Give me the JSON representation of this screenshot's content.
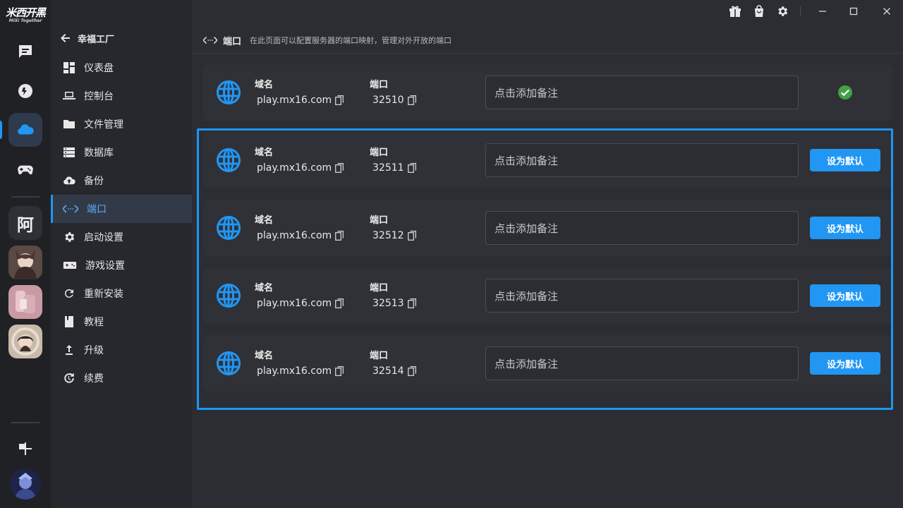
{
  "app": {
    "logo_text": "米西开黑",
    "logo_sub": "MiXi Together",
    "rail_avatar_text": "阿"
  },
  "nav": {
    "back_title": "幸福工厂",
    "items": [
      {
        "label": "仪表盘",
        "icon": "dashboard-icon"
      },
      {
        "label": "控制台",
        "icon": "laptop-icon"
      },
      {
        "label": "文件管理",
        "icon": "folder-icon"
      },
      {
        "label": "数据库",
        "icon": "database-icon"
      },
      {
        "label": "备份",
        "icon": "cloud-upload-icon"
      },
      {
        "label": "端口",
        "icon": "port-icon"
      },
      {
        "label": "启动设置",
        "icon": "gear-icon"
      },
      {
        "label": "游戏设置",
        "icon": "controller-icon"
      },
      {
        "label": "重新安装",
        "icon": "refresh-icon"
      },
      {
        "label": "教程",
        "icon": "book-icon"
      },
      {
        "label": "升级",
        "icon": "upgrade-icon"
      },
      {
        "label": "续费",
        "icon": "renew-icon"
      }
    ]
  },
  "page": {
    "title": "端口",
    "description": "在此页面可以配置服务器的端口映射，管理对外开放的端口"
  },
  "labels": {
    "domain": "域名",
    "port": "端口",
    "note_placeholder": "点击添加备注",
    "set_default": "设为默认"
  },
  "ports": [
    {
      "domain": "play.mx16.com",
      "port": "32510",
      "is_default": true
    },
    {
      "domain": "play.mx16.com",
      "port": "32511",
      "is_default": false
    },
    {
      "domain": "play.mx16.com",
      "port": "32512",
      "is_default": false
    },
    {
      "domain": "play.mx16.com",
      "port": "32513",
      "is_default": false
    },
    {
      "domain": "play.mx16.com",
      "port": "32514",
      "is_default": false
    }
  ],
  "colors": {
    "accent": "#2196f3",
    "success": "#43a047",
    "background": "#2b2d33"
  }
}
